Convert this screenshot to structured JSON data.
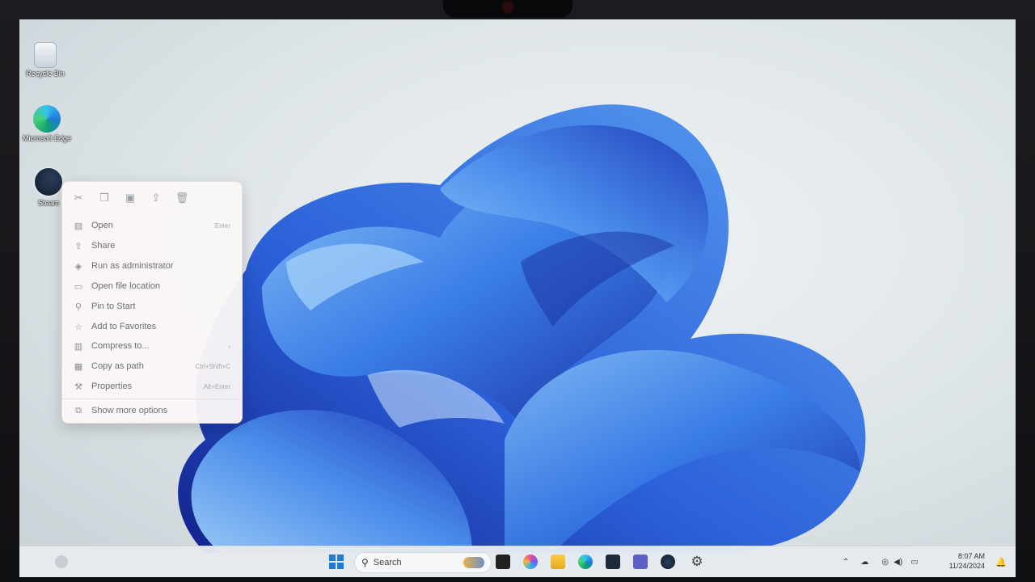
{
  "desktop": {
    "icons": [
      {
        "label": "Recycle Bin"
      },
      {
        "label": "Microsoft Edge"
      },
      {
        "label": "Steam"
      }
    ]
  },
  "context_menu": {
    "quick_actions": [
      "cut-icon",
      "copy-icon",
      "rename-icon",
      "share-icon",
      "delete-icon"
    ],
    "items": [
      {
        "label": "Open",
        "shortcut": "Enter",
        "icon": "open-icon"
      },
      {
        "label": "Share",
        "shortcut": "",
        "icon": "share-icon"
      },
      {
        "label": "Run as administrator",
        "shortcut": "",
        "icon": "shield-icon"
      },
      {
        "label": "Open file location",
        "shortcut": "",
        "icon": "folder-icon"
      },
      {
        "label": "Pin to Start",
        "shortcut": "",
        "icon": "pin-icon"
      },
      {
        "label": "Add to Favorites",
        "shortcut": "",
        "icon": "star-icon"
      },
      {
        "label": "Compress to...",
        "shortcut": "",
        "icon": "archive-icon"
      },
      {
        "label": "Copy as path",
        "shortcut": "Ctrl+Shift+C",
        "icon": "path-icon"
      },
      {
        "label": "Properties",
        "shortcut": "Alt+Enter",
        "icon": "wrench-icon"
      },
      {
        "label": "Show more options",
        "shortcut": "",
        "icon": "more-options-icon"
      }
    ]
  },
  "taskbar": {
    "search_label": "Search",
    "clock": {
      "time": "8:07 AM",
      "date": "11/24/2024"
    }
  },
  "colors": {
    "accent": "#1f5ae0",
    "wallpaper_light": "#7fb8f2",
    "wallpaper_dark": "#1c2fa8"
  }
}
